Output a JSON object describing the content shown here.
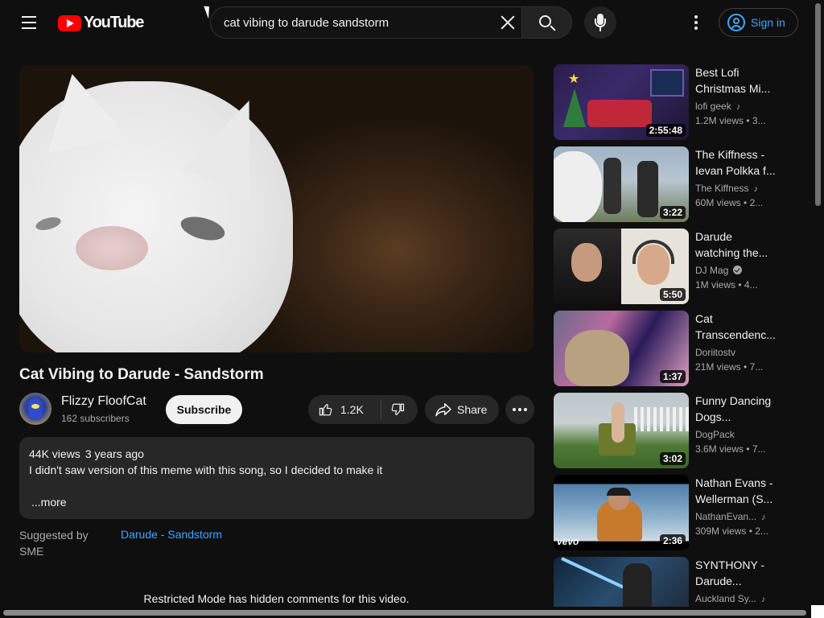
{
  "header": {
    "logo_text": "YouTube",
    "search": {
      "value": "cat vibing to darude sandstorm",
      "placeholder": "Search"
    },
    "signin_label": "Sign in"
  },
  "video": {
    "title": "Cat Vibing to Darude - Sandstorm",
    "channel": {
      "name": "Flizzy FloofCat",
      "subscribers": "162 subscribers"
    },
    "subscribe_label": "Subscribe",
    "likes": "1.2K",
    "share_label": "Share",
    "views": "44K views",
    "age": "3 years ago",
    "description": "I didn't saw version of this meme with this song, so I decided to make it",
    "more_label": "...more",
    "suggested_label": "Suggested by SME",
    "suggested_link": "Darude - Sandstorm",
    "restricted_notice": "Restricted Mode has hidden comments for this video."
  },
  "recommendations": [
    {
      "title1": "Best Lofi",
      "title2": "Christmas Mi...",
      "channel": "lofi geek",
      "badge": "music-note",
      "views": "1.2M views",
      "age": "3...",
      "duration": "2:55:48"
    },
    {
      "title1": "The Kiffness -",
      "title2": "Ievan Polkka f...",
      "channel": "The Kiffness",
      "badge": "music-note",
      "views": "60M views",
      "age": "2...",
      "duration": "3:22"
    },
    {
      "title1": "Darude",
      "title2": "watching the...",
      "channel": "DJ Mag",
      "badge": "verified",
      "views": "1M views",
      "age": "4...",
      "duration": "5:50"
    },
    {
      "title1": "Cat",
      "title2": "Transcendenc...",
      "channel": "Doriitostv",
      "badge": "",
      "views": "21M views",
      "age": "7...",
      "duration": "1:37"
    },
    {
      "title1": "Funny Dancing",
      "title2": "Dogs...",
      "channel": "DogPack",
      "badge": "",
      "views": "3.6M views",
      "age": "7...",
      "duration": "3:02"
    },
    {
      "title1": "Nathan Evans -",
      "title2": "Wellerman (S...",
      "channel": "NathanEvan...",
      "badge": "music-note",
      "views": "309M views",
      "age": "2...",
      "duration": "2:36",
      "thumb_label": "vevo"
    },
    {
      "title1": "SYNTHONY -",
      "title2": "Darude...",
      "channel": "Auckland Sy...",
      "badge": "music-note",
      "views": "",
      "age": "",
      "duration": ""
    }
  ]
}
